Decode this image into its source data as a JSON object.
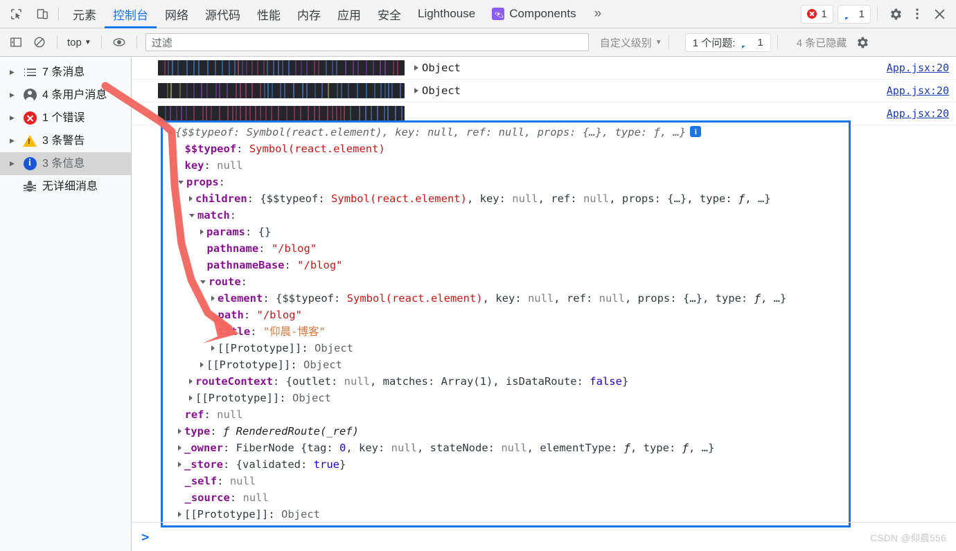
{
  "window": {
    "tabs": [
      {
        "label": "元素",
        "active": false,
        "icon": null
      },
      {
        "label": "控制台",
        "active": true,
        "icon": null
      },
      {
        "label": "网络",
        "active": false,
        "icon": null
      },
      {
        "label": "源代码",
        "active": false,
        "icon": null
      },
      {
        "label": "性能",
        "active": false,
        "icon": null
      },
      {
        "label": "内存",
        "active": false,
        "icon": null
      },
      {
        "label": "应用",
        "active": false,
        "icon": null
      },
      {
        "label": "安全",
        "active": false,
        "icon": null
      },
      {
        "label": "Lighthouse",
        "active": false,
        "icon": null
      },
      {
        "label": "Components",
        "active": false,
        "icon": "react-icon"
      }
    ],
    "more_label": "»",
    "error_count": "1",
    "message_count": "1",
    "inspect_icon": "inspect-element-icon",
    "device_icon": "device-toolbar-icon",
    "settings_icon": "gear-icon",
    "kebab_icon": "more-options-icon",
    "close_icon": "close-icon"
  },
  "filterbar": {
    "sidebar_toggle_icon": "console-sidebar-icon",
    "clear_icon": "clear-console-icon",
    "context": "top",
    "context_caret": "▼",
    "eye_icon": "live-expression-icon",
    "filter_placeholder": "过滤",
    "filter_value": "",
    "level": "自定义级别",
    "level_caret": "▼",
    "issues_label": "1 个问题:",
    "issues_count": "1",
    "hidden_label": "4 条已隐藏",
    "settings_icon": "gear-icon"
  },
  "sidebar": {
    "items": [
      {
        "label": "7 条消息",
        "icon": "list-icon",
        "expandable": true,
        "selected": false
      },
      {
        "label": "4 条用户消息",
        "icon": "user-icon",
        "expandable": true,
        "selected": false
      },
      {
        "label": "1 个错误",
        "icon": "error-icon",
        "expandable": true,
        "selected": false
      },
      {
        "label": "3 条警告",
        "icon": "warning-icon",
        "expandable": true,
        "selected": false
      },
      {
        "label": "3 条信息",
        "icon": "info-icon",
        "expandable": true,
        "selected": true
      },
      {
        "label": "无详细消息",
        "icon": "bug-icon",
        "expandable": false,
        "selected": false
      }
    ]
  },
  "console": {
    "log_rows": [
      {
        "redacted_width": 356,
        "object_label": "Object",
        "source": "App.jsx:20",
        "has_object": true
      },
      {
        "redacted_width": 356,
        "object_label": "Object",
        "source": "App.jsx:20",
        "has_object": true
      },
      {
        "redacted_width": 356,
        "object_label": "",
        "source": "App.jsx:20",
        "has_object": false
      }
    ],
    "prompt_symbol": ">",
    "prompt_value": "",
    "watermark": "CSDN @仰晨556"
  },
  "object_tree": {
    "selected": true,
    "border_color": "#1a73e8",
    "lines": [
      {
        "indent": 0,
        "arrow": "open",
        "parts": [
          {
            "t": "{$$typeof: ",
            "c": "preview"
          },
          {
            "t": "Symbol(react.element)",
            "c": "preview-sym"
          },
          {
            "t": ", key: ",
            "c": "preview"
          },
          {
            "t": "null",
            "c": "preview"
          },
          {
            "t": ", ref: ",
            "c": "preview"
          },
          {
            "t": "null",
            "c": "preview"
          },
          {
            "t": ", props: ",
            "c": "preview"
          },
          {
            "t": "{…}",
            "c": "preview"
          },
          {
            "t": ", type: ",
            "c": "preview"
          },
          {
            "t": "ƒ",
            "c": "preview"
          },
          {
            "t": ", …}",
            "c": "preview"
          }
        ],
        "badge": "i"
      },
      {
        "indent": 1,
        "arrow": "none",
        "parts": [
          {
            "t": "$$typeof",
            "c": "k"
          },
          {
            "t": ": ",
            "c": "plain"
          },
          {
            "t": "Symbol(react.element)",
            "c": "sym"
          }
        ]
      },
      {
        "indent": 1,
        "arrow": "none",
        "parts": [
          {
            "t": "key",
            "c": "k"
          },
          {
            "t": ": ",
            "c": "plain"
          },
          {
            "t": "null",
            "c": "nullv"
          }
        ]
      },
      {
        "indent": 1,
        "arrow": "open",
        "parts": [
          {
            "t": "props",
            "c": "k"
          },
          {
            "t": ":",
            "c": "plain"
          }
        ]
      },
      {
        "indent": 2,
        "arrow": "closed",
        "parts": [
          {
            "t": "children",
            "c": "k"
          },
          {
            "t": ": ",
            "c": "plain"
          },
          {
            "t": "{$$typeof: ",
            "c": "plain"
          },
          {
            "t": "Symbol(react.element)",
            "c": "sym"
          },
          {
            "t": ", key: ",
            "c": "plain"
          },
          {
            "t": "null",
            "c": "nullv"
          },
          {
            "t": ", ref: ",
            "c": "plain"
          },
          {
            "t": "null",
            "c": "nullv"
          },
          {
            "t": ", props: ",
            "c": "plain"
          },
          {
            "t": "{…}",
            "c": "plain"
          },
          {
            "t": ", type: ",
            "c": "plain"
          },
          {
            "t": "ƒ",
            "c": "fn"
          },
          {
            "t": ", …}",
            "c": "plain"
          }
        ]
      },
      {
        "indent": 2,
        "arrow": "open",
        "parts": [
          {
            "t": "match",
            "c": "k"
          },
          {
            "t": ":",
            "c": "plain"
          }
        ]
      },
      {
        "indent": 3,
        "arrow": "closed",
        "parts": [
          {
            "t": "params",
            "c": "k"
          },
          {
            "t": ": ",
            "c": "plain"
          },
          {
            "t": "{}",
            "c": "plain"
          }
        ]
      },
      {
        "indent": 3,
        "arrow": "none",
        "parts": [
          {
            "t": "pathname",
            "c": "k"
          },
          {
            "t": ": ",
            "c": "plain"
          },
          {
            "t": "\"/blog\"",
            "c": "strv"
          }
        ]
      },
      {
        "indent": 3,
        "arrow": "none",
        "parts": [
          {
            "t": "pathnameBase",
            "c": "k"
          },
          {
            "t": ": ",
            "c": "plain"
          },
          {
            "t": "\"/blog\"",
            "c": "strv"
          }
        ]
      },
      {
        "indent": 3,
        "arrow": "open",
        "parts": [
          {
            "t": "route",
            "c": "k"
          },
          {
            "t": ":",
            "c": "plain"
          }
        ]
      },
      {
        "indent": 4,
        "arrow": "closed",
        "parts": [
          {
            "t": "element",
            "c": "k"
          },
          {
            "t": ": ",
            "c": "plain"
          },
          {
            "t": "{$$typeof: ",
            "c": "plain"
          },
          {
            "t": "Symbol(react.element)",
            "c": "sym"
          },
          {
            "t": ", key: ",
            "c": "plain"
          },
          {
            "t": "null",
            "c": "nullv"
          },
          {
            "t": ", ref: ",
            "c": "plain"
          },
          {
            "t": "null",
            "c": "nullv"
          },
          {
            "t": ", props: ",
            "c": "plain"
          },
          {
            "t": "{…}",
            "c": "plain"
          },
          {
            "t": ", type: ",
            "c": "plain"
          },
          {
            "t": "ƒ",
            "c": "fn"
          },
          {
            "t": ", …}",
            "c": "plain"
          }
        ]
      },
      {
        "indent": 4,
        "arrow": "none",
        "parts": [
          {
            "t": "path",
            "c": "k"
          },
          {
            "t": ": ",
            "c": "plain"
          },
          {
            "t": "\"/blog\"",
            "c": "strv"
          }
        ]
      },
      {
        "indent": 4,
        "arrow": "none",
        "parts": [
          {
            "t": "title",
            "c": "k"
          },
          {
            "t": ": ",
            "c": "plain"
          },
          {
            "t": "\"仰晨-博客\"",
            "c": "strv-o"
          }
        ]
      },
      {
        "indent": 4,
        "arrow": "closed",
        "parts": [
          {
            "t": "[[Prototype]]",
            "c": "plain"
          },
          {
            "t": ": ",
            "c": "plain"
          },
          {
            "t": "Object",
            "c": "objname"
          }
        ]
      },
      {
        "indent": 3,
        "arrow": "closed",
        "parts": [
          {
            "t": "[[Prototype]]",
            "c": "plain"
          },
          {
            "t": ": ",
            "c": "plain"
          },
          {
            "t": "Object",
            "c": "objname"
          }
        ]
      },
      {
        "indent": 2,
        "arrow": "closed",
        "parts": [
          {
            "t": "routeContext",
            "c": "k"
          },
          {
            "t": ": ",
            "c": "plain"
          },
          {
            "t": "{outlet: ",
            "c": "plain"
          },
          {
            "t": "null",
            "c": "nullv"
          },
          {
            "t": ", matches: ",
            "c": "plain"
          },
          {
            "t": "Array(1)",
            "c": "plain"
          },
          {
            "t": ", isDataRoute: ",
            "c": "plain"
          },
          {
            "t": "false",
            "c": "boolv"
          },
          {
            "t": "}",
            "c": "plain"
          }
        ]
      },
      {
        "indent": 2,
        "arrow": "closed",
        "parts": [
          {
            "t": "[[Prototype]]",
            "c": "plain"
          },
          {
            "t": ": ",
            "c": "plain"
          },
          {
            "t": "Object",
            "c": "objname"
          }
        ]
      },
      {
        "indent": 1,
        "arrow": "none",
        "parts": [
          {
            "t": "ref",
            "c": "k"
          },
          {
            "t": ": ",
            "c": "plain"
          },
          {
            "t": "null",
            "c": "nullv"
          }
        ]
      },
      {
        "indent": 1,
        "arrow": "closed",
        "parts": [
          {
            "t": "type",
            "c": "k"
          },
          {
            "t": ": ",
            "c": "plain"
          },
          {
            "t": "ƒ RenderedRoute(_ref)",
            "c": "fn"
          }
        ]
      },
      {
        "indent": 1,
        "arrow": "closed",
        "parts": [
          {
            "t": "_owner",
            "c": "k"
          },
          {
            "t": ": ",
            "c": "plain"
          },
          {
            "t": "FiberNode ",
            "c": "plain"
          },
          {
            "t": "{tag: ",
            "c": "plain"
          },
          {
            "t": "0",
            "c": "numv"
          },
          {
            "t": ", key: ",
            "c": "plain"
          },
          {
            "t": "null",
            "c": "nullv"
          },
          {
            "t": ", stateNode: ",
            "c": "plain"
          },
          {
            "t": "null",
            "c": "nullv"
          },
          {
            "t": ", elementType: ",
            "c": "plain"
          },
          {
            "t": "ƒ",
            "c": "fn"
          },
          {
            "t": ", type: ",
            "c": "plain"
          },
          {
            "t": "ƒ",
            "c": "fn"
          },
          {
            "t": ", …}",
            "c": "plain"
          }
        ]
      },
      {
        "indent": 1,
        "arrow": "closed",
        "parts": [
          {
            "t": "_store",
            "c": "k"
          },
          {
            "t": ": ",
            "c": "plain"
          },
          {
            "t": "{validated: ",
            "c": "plain"
          },
          {
            "t": "true",
            "c": "boolv"
          },
          {
            "t": "}",
            "c": "plain"
          }
        ]
      },
      {
        "indent": 1,
        "arrow": "none",
        "parts": [
          {
            "t": "_self",
            "c": "k"
          },
          {
            "t": ": ",
            "c": "plain"
          },
          {
            "t": "null",
            "c": "nullv"
          }
        ]
      },
      {
        "indent": 1,
        "arrow": "none",
        "parts": [
          {
            "t": "_source",
            "c": "k"
          },
          {
            "t": ": ",
            "c": "plain"
          },
          {
            "t": "null",
            "c": "nullv"
          }
        ]
      },
      {
        "indent": 1,
        "arrow": "closed",
        "parts": [
          {
            "t": "[[Prototype]]",
            "c": "plain"
          },
          {
            "t": ": ",
            "c": "plain"
          },
          {
            "t": "Object",
            "c": "objname"
          }
        ]
      }
    ]
  },
  "annotation": {
    "color": "#f2655f",
    "type": "arrow-annotation"
  }
}
